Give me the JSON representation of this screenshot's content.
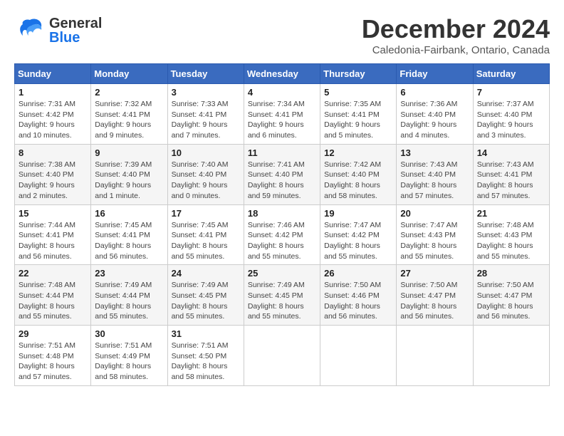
{
  "header": {
    "logo_general": "General",
    "logo_blue": "Blue",
    "month": "December 2024",
    "location": "Caledonia-Fairbank, Ontario, Canada"
  },
  "weekdays": [
    "Sunday",
    "Monday",
    "Tuesday",
    "Wednesday",
    "Thursday",
    "Friday",
    "Saturday"
  ],
  "weeks": [
    [
      {
        "day": "1",
        "info": "Sunrise: 7:31 AM\nSunset: 4:42 PM\nDaylight: 9 hours\nand 10 minutes."
      },
      {
        "day": "2",
        "info": "Sunrise: 7:32 AM\nSunset: 4:41 PM\nDaylight: 9 hours\nand 9 minutes."
      },
      {
        "day": "3",
        "info": "Sunrise: 7:33 AM\nSunset: 4:41 PM\nDaylight: 9 hours\nand 7 minutes."
      },
      {
        "day": "4",
        "info": "Sunrise: 7:34 AM\nSunset: 4:41 PM\nDaylight: 9 hours\nand 6 minutes."
      },
      {
        "day": "5",
        "info": "Sunrise: 7:35 AM\nSunset: 4:41 PM\nDaylight: 9 hours\nand 5 minutes."
      },
      {
        "day": "6",
        "info": "Sunrise: 7:36 AM\nSunset: 4:40 PM\nDaylight: 9 hours\nand 4 minutes."
      },
      {
        "day": "7",
        "info": "Sunrise: 7:37 AM\nSunset: 4:40 PM\nDaylight: 9 hours\nand 3 minutes."
      }
    ],
    [
      {
        "day": "8",
        "info": "Sunrise: 7:38 AM\nSunset: 4:40 PM\nDaylight: 9 hours\nand 2 minutes."
      },
      {
        "day": "9",
        "info": "Sunrise: 7:39 AM\nSunset: 4:40 PM\nDaylight: 9 hours\nand 1 minute."
      },
      {
        "day": "10",
        "info": "Sunrise: 7:40 AM\nSunset: 4:40 PM\nDaylight: 9 hours\nand 0 minutes."
      },
      {
        "day": "11",
        "info": "Sunrise: 7:41 AM\nSunset: 4:40 PM\nDaylight: 8 hours\nand 59 minutes."
      },
      {
        "day": "12",
        "info": "Sunrise: 7:42 AM\nSunset: 4:40 PM\nDaylight: 8 hours\nand 58 minutes."
      },
      {
        "day": "13",
        "info": "Sunrise: 7:43 AM\nSunset: 4:40 PM\nDaylight: 8 hours\nand 57 minutes."
      },
      {
        "day": "14",
        "info": "Sunrise: 7:43 AM\nSunset: 4:41 PM\nDaylight: 8 hours\nand 57 minutes."
      }
    ],
    [
      {
        "day": "15",
        "info": "Sunrise: 7:44 AM\nSunset: 4:41 PM\nDaylight: 8 hours\nand 56 minutes."
      },
      {
        "day": "16",
        "info": "Sunrise: 7:45 AM\nSunset: 4:41 PM\nDaylight: 8 hours\nand 56 minutes."
      },
      {
        "day": "17",
        "info": "Sunrise: 7:45 AM\nSunset: 4:41 PM\nDaylight: 8 hours\nand 55 minutes."
      },
      {
        "day": "18",
        "info": "Sunrise: 7:46 AM\nSunset: 4:42 PM\nDaylight: 8 hours\nand 55 minutes."
      },
      {
        "day": "19",
        "info": "Sunrise: 7:47 AM\nSunset: 4:42 PM\nDaylight: 8 hours\nand 55 minutes."
      },
      {
        "day": "20",
        "info": "Sunrise: 7:47 AM\nSunset: 4:43 PM\nDaylight: 8 hours\nand 55 minutes."
      },
      {
        "day": "21",
        "info": "Sunrise: 7:48 AM\nSunset: 4:43 PM\nDaylight: 8 hours\nand 55 minutes."
      }
    ],
    [
      {
        "day": "22",
        "info": "Sunrise: 7:48 AM\nSunset: 4:44 PM\nDaylight: 8 hours\nand 55 minutes."
      },
      {
        "day": "23",
        "info": "Sunrise: 7:49 AM\nSunset: 4:44 PM\nDaylight: 8 hours\nand 55 minutes."
      },
      {
        "day": "24",
        "info": "Sunrise: 7:49 AM\nSunset: 4:45 PM\nDaylight: 8 hours\nand 55 minutes."
      },
      {
        "day": "25",
        "info": "Sunrise: 7:49 AM\nSunset: 4:45 PM\nDaylight: 8 hours\nand 55 minutes."
      },
      {
        "day": "26",
        "info": "Sunrise: 7:50 AM\nSunset: 4:46 PM\nDaylight: 8 hours\nand 56 minutes."
      },
      {
        "day": "27",
        "info": "Sunrise: 7:50 AM\nSunset: 4:47 PM\nDaylight: 8 hours\nand 56 minutes."
      },
      {
        "day": "28",
        "info": "Sunrise: 7:50 AM\nSunset: 4:47 PM\nDaylight: 8 hours\nand 56 minutes."
      }
    ],
    [
      {
        "day": "29",
        "info": "Sunrise: 7:51 AM\nSunset: 4:48 PM\nDaylight: 8 hours\nand 57 minutes."
      },
      {
        "day": "30",
        "info": "Sunrise: 7:51 AM\nSunset: 4:49 PM\nDaylight: 8 hours\nand 58 minutes."
      },
      {
        "day": "31",
        "info": "Sunrise: 7:51 AM\nSunset: 4:50 PM\nDaylight: 8 hours\nand 58 minutes."
      },
      {
        "day": "",
        "info": ""
      },
      {
        "day": "",
        "info": ""
      },
      {
        "day": "",
        "info": ""
      },
      {
        "day": "",
        "info": ""
      }
    ]
  ]
}
